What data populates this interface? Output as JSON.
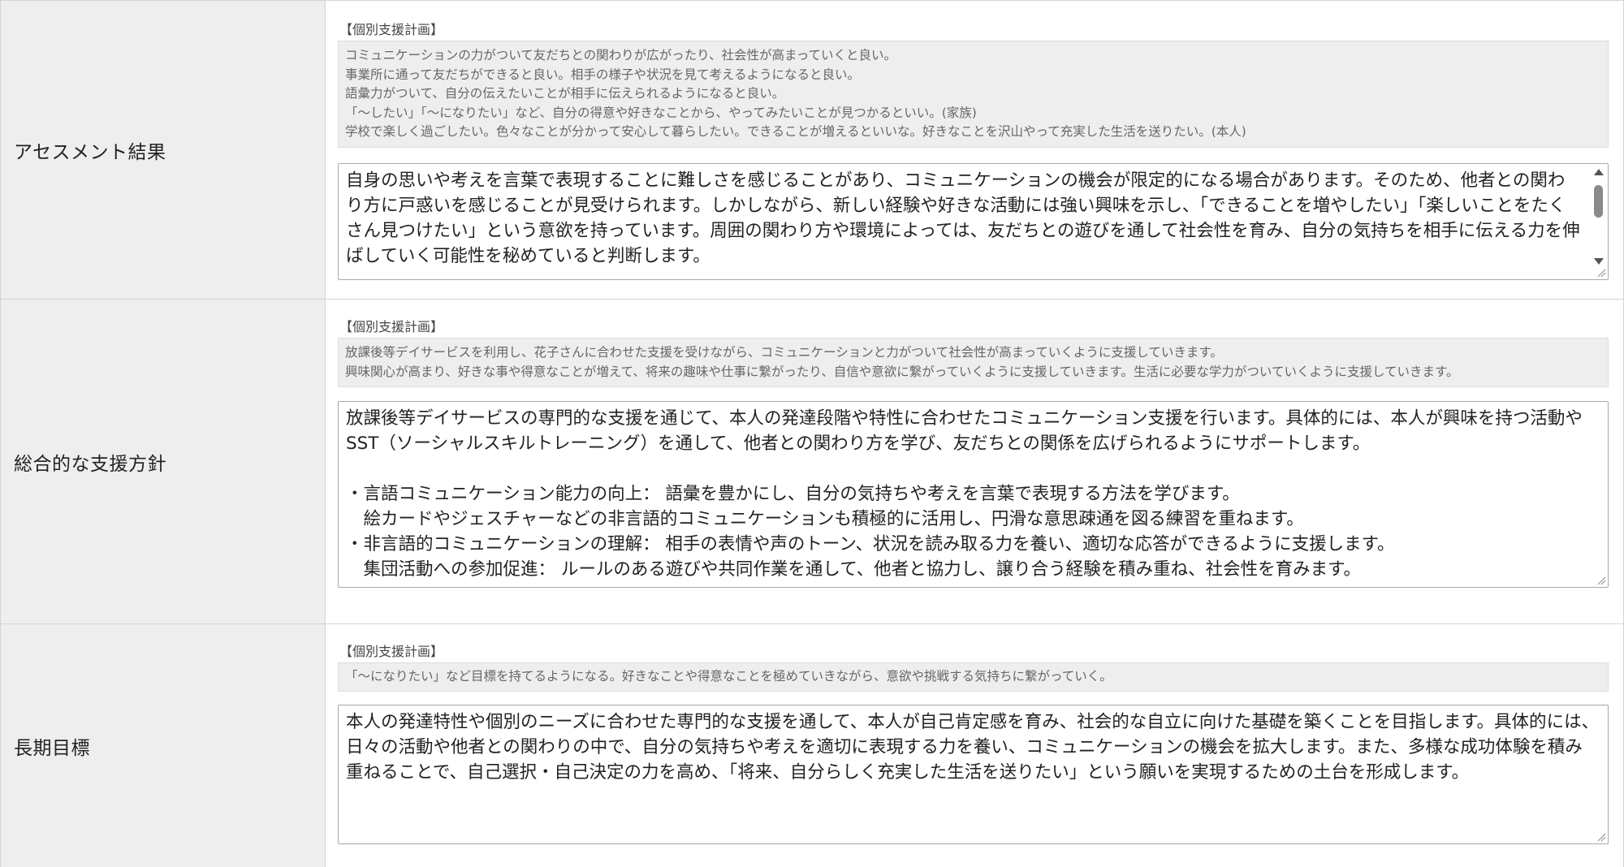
{
  "sections": [
    {
      "label": "アセスメント結果",
      "ref_heading": "【個別支援計画】",
      "ref_lines": [
        "コミュニケーションの力がついて友だちとの関わりが広がったり、社会性が高まっていくと良い。",
        "事業所に通って友だちができると良い。相手の様子や状況を見て考えるようになると良い。",
        "語彙力がついて、自分の伝えたいことが相手に伝えられるようになると良い。",
        "「～したい」「～になりたい」など、自分の得意や好きなことから、やってみたいことが見つかるといい。(家族)",
        "学校で楽しく過ごしたい。色々なことが分かって安心して暮らしたい。できることが増えるといいな。好きなことを沢山やって充実した生活を送りたい。(本人)"
      ],
      "text": "自身の思いや考えを言葉で表現することに難しさを感じることがあり、コミュニケーションの機会が限定的になる場合があります。そのため、他者との関わり方に戸惑いを感じることが見受けられます。しかしながら、新しい経験や好きな活動には強い興味を示し、「できることを増やしたい」「楽しいことをたくさん見つけたい」という意欲を持っています。周囲の関わり方や環境によっては、友だちとの遊びを通して社会性を育み、自分の気持ちを相手に伝える力を伸ばしていく可能性を秘めていると判断します。"
    },
    {
      "label": "総合的な支援方針",
      "ref_heading": "【個別支援計画】",
      "ref_lines": [
        "放課後等デイサービスを利用し、花子さんに合わせた支援を受けながら、コミュニケーションと力がついて社会性が高まっていくように支援していきます。",
        "興味関心が高まり、好きな事や得意なことが増えて、将来の趣味や仕事に繋がったり、自信や意欲に繋がっていくように支援していきます。生活に必要な学力がついていくように支援していきます。"
      ],
      "text": "放課後等デイサービスの専門的な支援を通じて、本人の発達段階や特性に合わせたコミュニケーション支援を行います。具体的には、本人が興味を持つ活動やSST（ソーシャルスキルトレーニング）を通して、他者との関わり方を学び、友だちとの関係を広げられるようにサポートします。\n\n・言語コミュニケーション能力の向上： 語彙を豊かにし、自分の気持ちや考えを言葉で表現する方法を学びます。\n　絵カードやジェスチャーなどの非言語的コミュニケーションも積極的に活用し、円滑な意思疎通を図る練習を重ねます。\n・非言語的コミュニケーションの理解： 相手の表情や声のトーン、状況を読み取る力を養い、適切な応答ができるように支援します。\n　集団活動への参加促進： ルールのある遊びや共同作業を通して、他者と協力し、譲り合う経験を積み重ね、社会性を育みます。"
    },
    {
      "label": "長期目標",
      "ref_heading": "【個別支援計画】",
      "ref_lines": [
        "「～になりたい」など目標を持てるようになる。好きなことや得意なことを極めていきながら、意欲や挑戦する気持ちに繋がっていく。"
      ],
      "text": "本人の発達特性や個別のニーズに合わせた専門的な支援を通して、本人が自己肯定感を育み、社会的な自立に向けた基礎を築くことを目指します。具体的には、日々の活動や他者との関わりの中で、自分の気持ちや考えを適切に表現する力を養い、コミュニケーションの機会を拡大します。また、多様な成功体験を積み重ねることで、自己選択・自己決定の力を高め、「将来、自分らしく充実した生活を送りたい」という願いを実現するための土台を形成します。"
    }
  ]
}
